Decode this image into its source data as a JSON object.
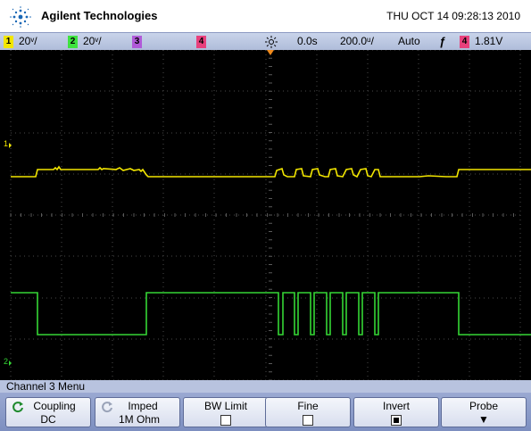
{
  "header": {
    "brand": "Agilent Technologies",
    "datetime": "THU OCT 14 09:28:13 2010"
  },
  "statusbar": {
    "ch1": {
      "num": "1",
      "scale": "20ᵛ/",
      "color": "#f2e600"
    },
    "ch2": {
      "num": "2",
      "scale": "20ᵛ/",
      "color": "#3fe23f"
    },
    "ch3": {
      "num": "3",
      "color": "#b05ad8"
    },
    "ch4": {
      "num": "4",
      "color": "#e8407c"
    },
    "time_offset": "0.0s",
    "time_scale": "200.0ᵘ/",
    "trigger_mode": "Auto",
    "trigger_source": "4",
    "trigger_level": "1.81V"
  },
  "screen": {
    "ch1_marker": "1",
    "ch2_marker": "2",
    "ch1_color": "#f2e600",
    "ch2_color": "#35d635"
  },
  "menu": {
    "title": "Channel 3  Menu"
  },
  "softkeys": [
    {
      "label": "Coupling",
      "value": "DC"
    },
    {
      "label": "Imped",
      "value": "1M Ohm"
    },
    {
      "label": "BW Limit",
      "value": ""
    },
    {
      "label": "Fine",
      "value": ""
    },
    {
      "label": "Invert",
      "value": ""
    },
    {
      "label": "Probe",
      "value": ""
    }
  ]
}
